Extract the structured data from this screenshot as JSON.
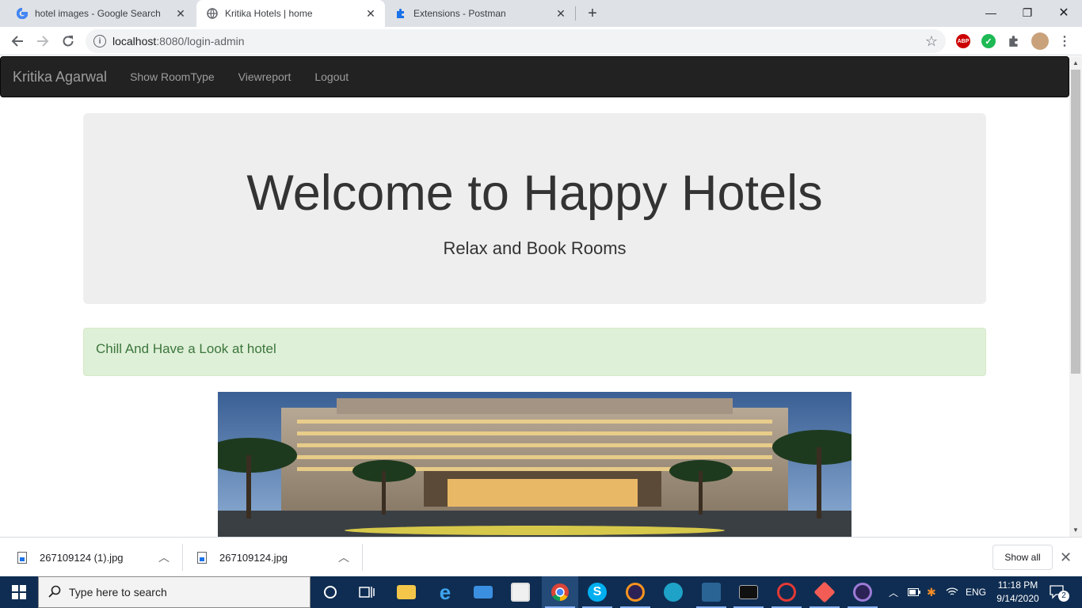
{
  "browser": {
    "tabs": [
      {
        "label": "hotel images - Google Search",
        "icon": "google-icon"
      },
      {
        "label": "Kritika Hotels | home",
        "icon": "globe-icon"
      },
      {
        "label": "Extensions - Postman",
        "icon": "puzzle-icon"
      }
    ],
    "url_host": "localhost",
    "url_rest": ":8080/login-admin"
  },
  "page": {
    "navbar": {
      "brand": "Kritika Agarwal",
      "links": [
        "Show RoomType",
        "Viewreport",
        "Logout"
      ]
    },
    "jumbotron": {
      "title": "Welcome to Happy Hotels",
      "subtitle": "Relax and Book Rooms"
    },
    "alert": "Chill And Have a Look at hotel"
  },
  "downloads": {
    "items": [
      "267109124 (1).jpg",
      "267109124.jpg"
    ],
    "show_all": "Show all"
  },
  "taskbar": {
    "search_placeholder": "Type here to search",
    "lang": "ENG",
    "time": "11:18 PM",
    "date": "9/14/2020",
    "notifications": "2"
  }
}
